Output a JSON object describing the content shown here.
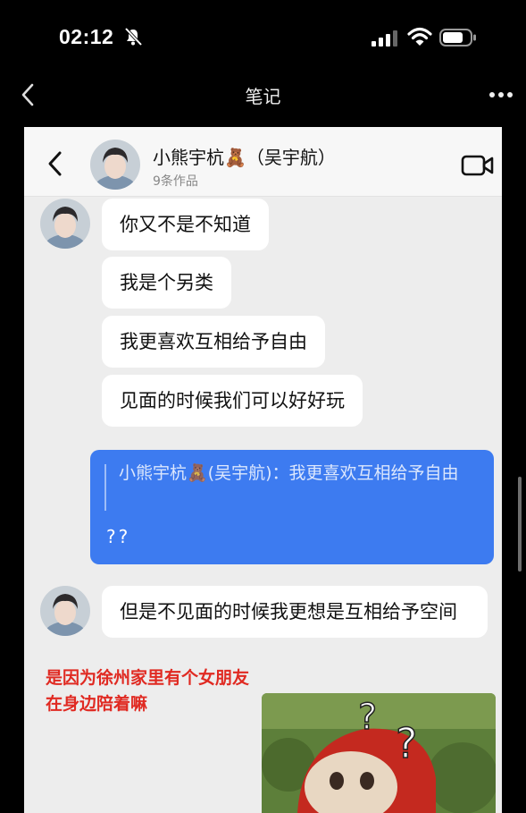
{
  "status_bar": {
    "time": "02:12"
  },
  "nav": {
    "title": "笔记"
  },
  "chat": {
    "contact_name": "小熊宇杭🧸（吴宇航）",
    "works_count": "9条作品",
    "received_1": [
      "你又不是不知道",
      "我是个另类",
      "我更喜欢互相给予自由",
      "见面的时候我们可以好好玩"
    ],
    "sent": {
      "quote": "小熊宇杭🧸(吴宇航)：我更喜欢互相给予自由",
      "text": "??"
    },
    "received_2": "但是不见面的时候我更想是互相给予空间"
  },
  "annotation": {
    "line1": "是因为徐州家里有个女朋友",
    "line2": "在身边陪着嘛"
  },
  "meme": {
    "glyph": "?"
  },
  "colors": {
    "sent_bubble": "#3d7bf0",
    "annotation": "#e02a22",
    "card_bg": "#ededed"
  }
}
